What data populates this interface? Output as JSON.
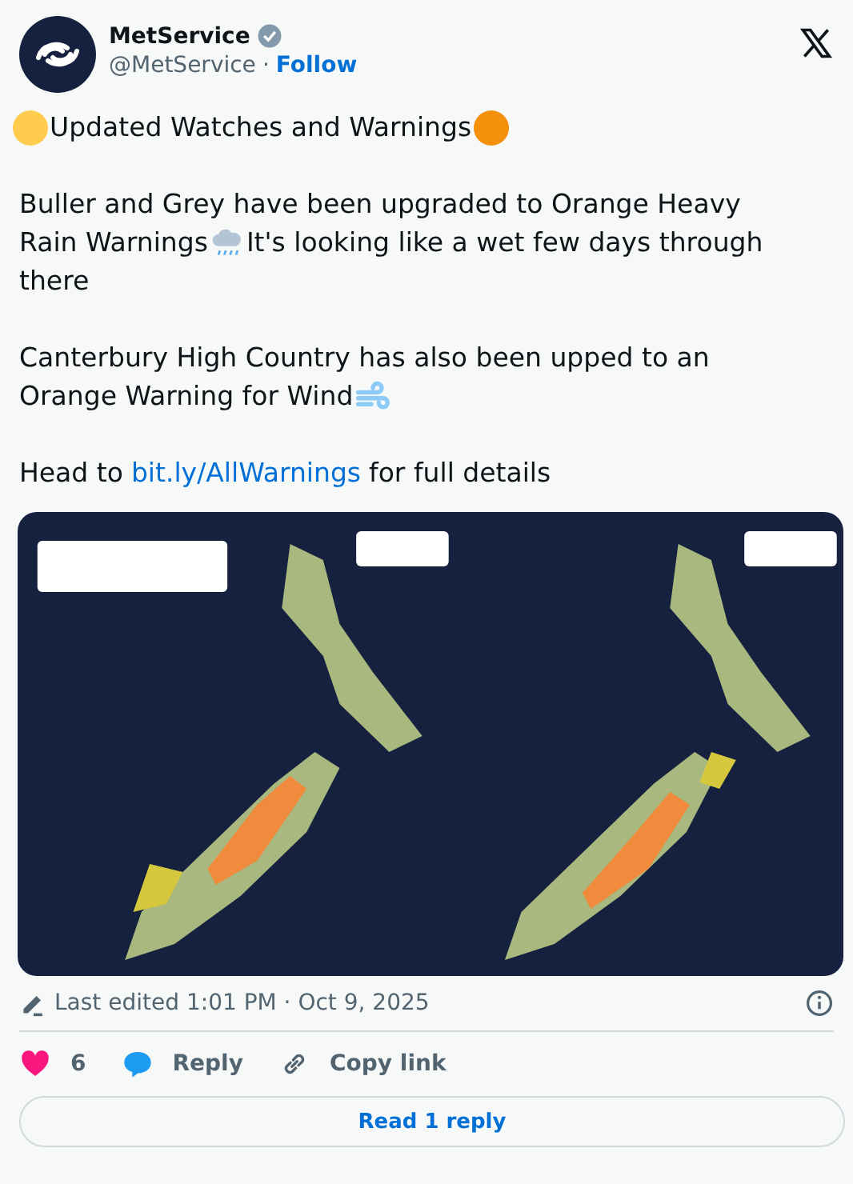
{
  "author": {
    "name": "MetService",
    "verified": true,
    "handle": "@MetService",
    "separator": "·",
    "follow": "Follow"
  },
  "paragraphs": [
    [
      [
        {
          "kind": "dot",
          "color": "#ffcc4d"
        },
        {
          "kind": "text",
          "text": "Updated Watches and Warnings"
        },
        {
          "kind": "dot",
          "color": "#f4900c"
        }
      ]
    ],
    [
      [
        {
          "kind": "text",
          "text": "Buller and Grey have been upgraded to Orange Heavy"
        }
      ],
      [
        {
          "kind": "text",
          "text": "Rain Warnings"
        },
        {
          "kind": "rain"
        },
        {
          "kind": "text",
          "text": "It's looking like a wet few days through"
        }
      ],
      [
        {
          "kind": "text",
          "text": "there"
        }
      ]
    ],
    [
      [
        {
          "kind": "text",
          "text": "Canterbury High Country has also been upped to an"
        }
      ],
      [
        {
          "kind": "text",
          "text": "Orange Warning for Wind"
        },
        {
          "kind": "wind"
        }
      ]
    ],
    [
      [
        {
          "kind": "text",
          "text": "Head to"
        },
        {
          "kind": "link",
          "text": "bit.ly/AllWarnings"
        },
        {
          "kind": "text",
          "text": "for full details"
        }
      ]
    ]
  ],
  "media": {
    "kind": "picture"
  },
  "edited": "Last edited 1:01 PM · Oct 9, 2025",
  "actions": [
    {
      "kind": "like",
      "label": "6"
    },
    {
      "kind": "reply",
      "label": "Reply"
    },
    {
      "kind": "copy",
      "label": "Copy link"
    }
  ],
  "read_replies": "Read 1 reply"
}
